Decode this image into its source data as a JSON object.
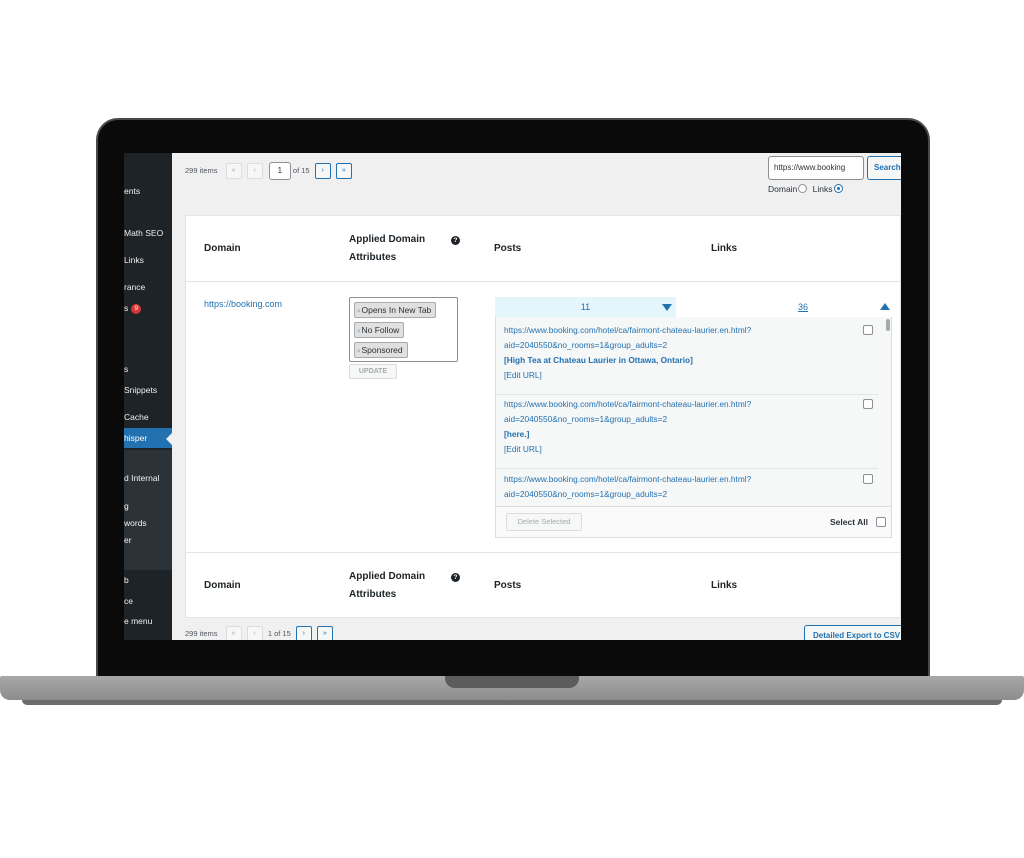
{
  "sidebar": {
    "items": [
      {
        "label": "ents"
      },
      {
        "label": "Math SEO"
      },
      {
        "label": "Links"
      },
      {
        "label": "rance"
      },
      {
        "label": "s",
        "badge": "9"
      },
      {
        "label": "s"
      },
      {
        "label": "Snippets"
      },
      {
        "label": "Cache"
      },
      {
        "label": "hisper"
      },
      {
        "label": "d Internal"
      },
      {
        "label": "g"
      },
      {
        "label": "words"
      },
      {
        "label": "er"
      },
      {
        "label": "b"
      },
      {
        "label": "ce"
      },
      {
        "label": "e menu"
      }
    ]
  },
  "top_nav": {
    "items_count": "299 items",
    "first": "«",
    "prev": "‹",
    "current_page": "1",
    "of_pages": "of 15",
    "next": "›",
    "last": "»"
  },
  "search": {
    "value": "https://www.booking",
    "button": "Search",
    "radio_domain": "Domain",
    "radio_links": "Links",
    "selected": "Links"
  },
  "table": {
    "headers": {
      "domain": "Domain",
      "attributes": "Applied Domain Attributes",
      "help": "?",
      "posts": "Posts",
      "links": "Links"
    },
    "row": {
      "domain": "https://booking.com",
      "attributes": [
        "Opens In New Tab",
        "No Follow",
        "Sponsored"
      ],
      "remove_symbol": "×",
      "update_button": "UPDATE",
      "posts_count": "11",
      "links_count": "36",
      "links": [
        {
          "url_line1": "https://www.booking.com/hotel/ca/fairmont-chateau-laurier.en.html?",
          "url_line2": "aid=2040550&no_rooms=1&group_adults=2",
          "title": "[High Tea at Chateau Laurier in Ottawa, Ontario]",
          "edit": "[Edit URL]"
        },
        {
          "url_line1": "https://www.booking.com/hotel/ca/fairmont-chateau-laurier.en.html?",
          "url_line2": "aid=2040550&no_rooms=1&group_adults=2",
          "title": "[here.]",
          "edit": "[Edit URL]"
        },
        {
          "url_line1": "https://www.booking.com/hotel/ca/fairmont-chateau-laurier.en.html?",
          "url_line2": "aid=2040550&no_rooms=1&group_adults=2"
        }
      ],
      "delete_selected": "Delete Selected",
      "select_all": "Select All"
    }
  },
  "bottom_nav": {
    "items_count": "299 items",
    "first": "«",
    "prev": "‹",
    "page_text": "1 of 15",
    "next": "›",
    "last": "»",
    "export_button": "Detailed Export to CSV"
  }
}
